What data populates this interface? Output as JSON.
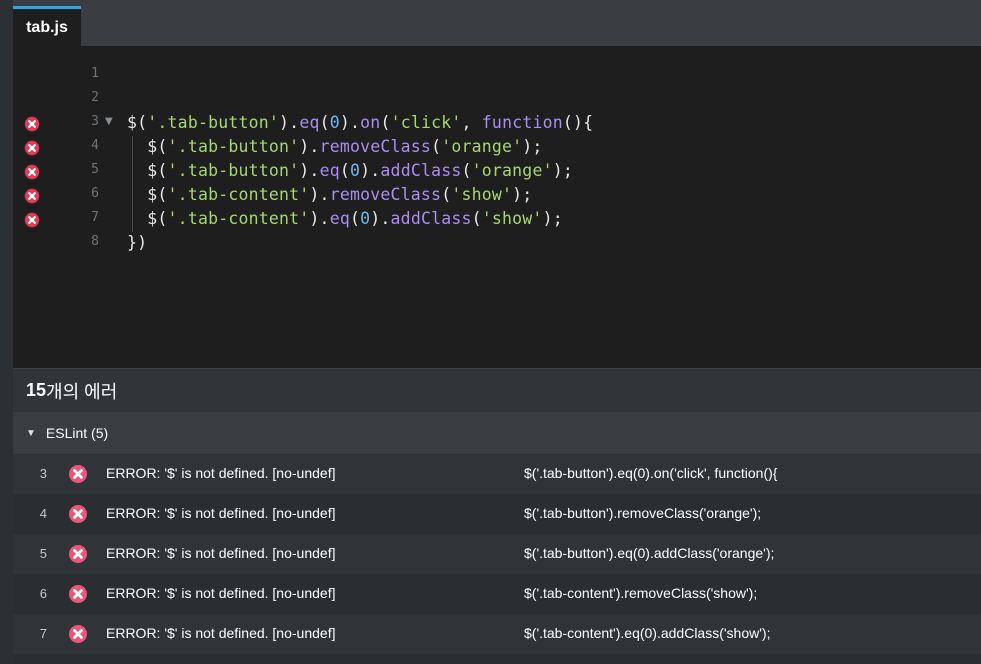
{
  "tabs": [
    {
      "label": "tab.js",
      "active": true
    }
  ],
  "editor": {
    "lines": [
      {
        "num": "1",
        "error": false,
        "fold": "",
        "indent": false,
        "tokens": []
      },
      {
        "num": "2",
        "error": false,
        "fold": "",
        "indent": false,
        "tokens": []
      },
      {
        "num": "3",
        "error": true,
        "fold": "▼",
        "indent": false,
        "tokens": [
          {
            "t": "$(",
            "c": ""
          },
          {
            "t": "'.tab-button'",
            "c": "str"
          },
          {
            "t": ").",
            "c": ""
          },
          {
            "t": "eq",
            "c": "fn"
          },
          {
            "t": "(",
            "c": ""
          },
          {
            "t": "0",
            "c": "num"
          },
          {
            "t": ").",
            "c": ""
          },
          {
            "t": "on",
            "c": "fn"
          },
          {
            "t": "(",
            "c": ""
          },
          {
            "t": "'click'",
            "c": "str"
          },
          {
            "t": ", ",
            "c": ""
          },
          {
            "t": "function",
            "c": "kw"
          },
          {
            "t": "(){",
            "c": ""
          }
        ]
      },
      {
        "num": "4",
        "error": true,
        "fold": "",
        "indent": true,
        "tokens": [
          {
            "t": "  $(",
            "c": ""
          },
          {
            "t": "'.tab-button'",
            "c": "str"
          },
          {
            "t": ").",
            "c": ""
          },
          {
            "t": "removeClass",
            "c": "fn"
          },
          {
            "t": "(",
            "c": ""
          },
          {
            "t": "'orange'",
            "c": "str"
          },
          {
            "t": ");",
            "c": ""
          }
        ]
      },
      {
        "num": "5",
        "error": true,
        "fold": "",
        "indent": true,
        "tokens": [
          {
            "t": "  $(",
            "c": ""
          },
          {
            "t": "'.tab-button'",
            "c": "str"
          },
          {
            "t": ").",
            "c": ""
          },
          {
            "t": "eq",
            "c": "fn"
          },
          {
            "t": "(",
            "c": ""
          },
          {
            "t": "0",
            "c": "num"
          },
          {
            "t": ").",
            "c": ""
          },
          {
            "t": "addClass",
            "c": "fn"
          },
          {
            "t": "(",
            "c": ""
          },
          {
            "t": "'orange'",
            "c": "str"
          },
          {
            "t": ");",
            "c": ""
          }
        ]
      },
      {
        "num": "6",
        "error": true,
        "fold": "",
        "indent": true,
        "tokens": [
          {
            "t": "  $(",
            "c": ""
          },
          {
            "t": "'.tab-content'",
            "c": "str"
          },
          {
            "t": ").",
            "c": ""
          },
          {
            "t": "removeClass",
            "c": "fn"
          },
          {
            "t": "(",
            "c": ""
          },
          {
            "t": "'show'",
            "c": "str"
          },
          {
            "t": ");",
            "c": ""
          }
        ]
      },
      {
        "num": "7",
        "error": true,
        "fold": "",
        "indent": true,
        "tokens": [
          {
            "t": "  $(",
            "c": ""
          },
          {
            "t": "'.tab-content'",
            "c": "str"
          },
          {
            "t": ").",
            "c": ""
          },
          {
            "t": "eq",
            "c": "fn"
          },
          {
            "t": "(",
            "c": ""
          },
          {
            "t": "0",
            "c": "num"
          },
          {
            "t": ").",
            "c": ""
          },
          {
            "t": "addClass",
            "c": "fn"
          },
          {
            "t": "(",
            "c": ""
          },
          {
            "t": "'show'",
            "c": "str"
          },
          {
            "t": ");",
            "c": ""
          }
        ]
      },
      {
        "num": "8",
        "error": false,
        "fold": "",
        "indent": false,
        "tokens": [
          {
            "t": "})",
            "c": ""
          }
        ]
      }
    ]
  },
  "problems": {
    "count": "15",
    "title_suffix": "개의 에러",
    "section": {
      "label": "ESLint (5)",
      "expanded_icon": "triangle-down-icon"
    },
    "rows": [
      {
        "line": "3",
        "message": "ERROR: '$' is not defined. [no-undef]",
        "code": "$('.tab-button').eq(0).on('click', function(){"
      },
      {
        "line": "4",
        "message": "ERROR: '$' is not defined. [no-undef]",
        "code": "$('.tab-button').removeClass('orange');"
      },
      {
        "line": "5",
        "message": "ERROR: '$' is not defined. [no-undef]",
        "code": "$('.tab-button').eq(0).addClass('orange');"
      },
      {
        "line": "6",
        "message": "ERROR: '$' is not defined. [no-undef]",
        "code": "$('.tab-content').removeClass('show');"
      },
      {
        "line": "7",
        "message": "ERROR: '$' is not defined. [no-undef]",
        "code": "$('.tab-content').eq(0).addClass('show');"
      }
    ]
  },
  "colors": {
    "accent": "#29a7e0",
    "error": "#e23a55",
    "error_panel": "#e8577a",
    "string": "#a8d672",
    "function": "#a98ef0",
    "number": "#76b4ee"
  },
  "icons": {
    "error_icon": "error-x-circle-icon"
  }
}
